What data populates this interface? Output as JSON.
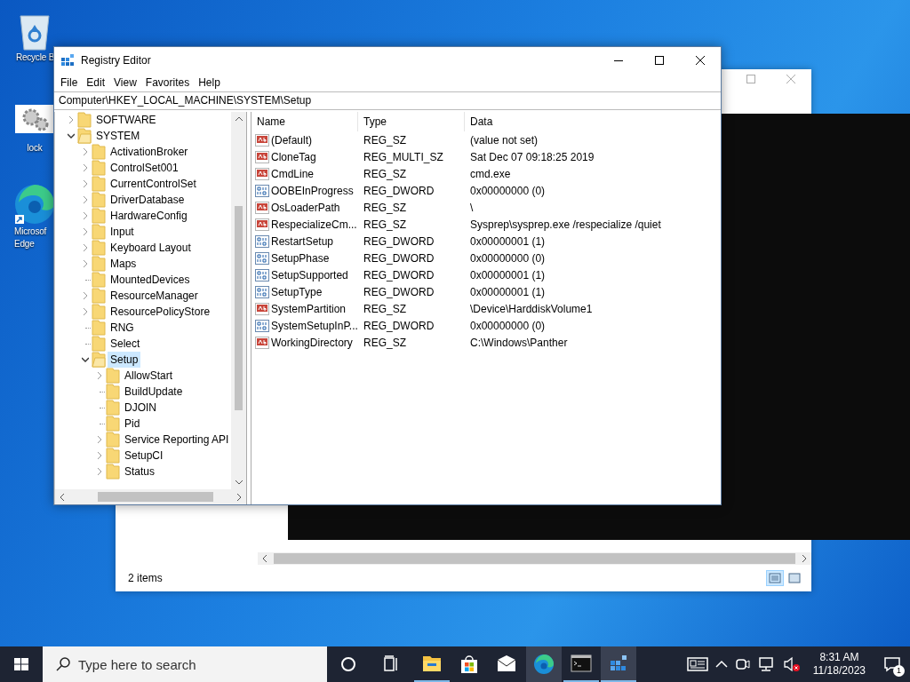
{
  "desktop_icons": [
    {
      "kind": "recycle",
      "lines": [
        "Recycle B"
      ]
    },
    {
      "kind": "gears",
      "lines": [
        "lock"
      ]
    },
    {
      "kind": "edge",
      "lines": [
        "Microsof",
        "Edge"
      ]
    }
  ],
  "explorer_window": {
    "status": "2 items"
  },
  "registry_editor": {
    "title": "Registry Editor",
    "menu": [
      "File",
      "Edit",
      "View",
      "Favorites",
      "Help"
    ],
    "address": "Computer\\HKEY_LOCAL_MACHINE\\SYSTEM\\Setup",
    "tree": [
      {
        "label": "SOFTWARE",
        "has_children": true,
        "expanded": false,
        "selected": false
      },
      {
        "label": "SYSTEM",
        "has_children": true,
        "expanded": true,
        "selected": false,
        "children": [
          {
            "label": "ActivationBroker",
            "has_children": true,
            "expanded": false,
            "selected": false
          },
          {
            "label": "ControlSet001",
            "has_children": true,
            "expanded": false,
            "selected": false
          },
          {
            "label": "CurrentControlSet",
            "has_children": true,
            "expanded": false,
            "selected": false
          },
          {
            "label": "DriverDatabase",
            "has_children": true,
            "expanded": false,
            "selected": false
          },
          {
            "label": "HardwareConfig",
            "has_children": true,
            "expanded": false,
            "selected": false
          },
          {
            "label": "Input",
            "has_children": true,
            "expanded": false,
            "selected": false
          },
          {
            "label": "Keyboard Layout",
            "has_children": true,
            "expanded": false,
            "selected": false
          },
          {
            "label": "Maps",
            "has_children": true,
            "expanded": false,
            "selected": false
          },
          {
            "label": "MountedDevices",
            "has_children": false,
            "expanded": false,
            "selected": false
          },
          {
            "label": "ResourceManager",
            "has_children": true,
            "expanded": false,
            "selected": false
          },
          {
            "label": "ResourcePolicyStore",
            "has_children": true,
            "expanded": false,
            "selected": false
          },
          {
            "label": "RNG",
            "has_children": false,
            "expanded": false,
            "selected": false
          },
          {
            "label": "Select",
            "has_children": false,
            "expanded": false,
            "selected": false
          },
          {
            "label": "Setup",
            "has_children": true,
            "expanded": true,
            "selected": true,
            "children": [
              {
                "label": "AllowStart",
                "has_children": true,
                "expanded": false,
                "selected": false
              },
              {
                "label": "BuildUpdate",
                "has_children": false,
                "expanded": false,
                "selected": false
              },
              {
                "label": "DJOIN",
                "has_children": false,
                "expanded": false,
                "selected": false
              },
              {
                "label": "Pid",
                "has_children": false,
                "expanded": false,
                "selected": false
              },
              {
                "label": "Service Reporting API",
                "has_children": true,
                "expanded": false,
                "selected": false
              },
              {
                "label": "SetupCI",
                "has_children": true,
                "expanded": false,
                "selected": false
              },
              {
                "label": "Status",
                "has_children": true,
                "expanded": false,
                "selected": false
              }
            ]
          }
        ]
      }
    ],
    "columns": [
      "Name",
      "Type",
      "Data"
    ],
    "values": [
      {
        "kind": "sz",
        "name": "(Default)",
        "type": "REG_SZ",
        "data": "(value not set)"
      },
      {
        "kind": "sz",
        "name": "CloneTag",
        "type": "REG_MULTI_SZ",
        "data": "Sat Dec 07 09:18:25 2019"
      },
      {
        "kind": "sz",
        "name": "CmdLine",
        "type": "REG_SZ",
        "data": "cmd.exe"
      },
      {
        "kind": "dword",
        "name": "OOBEInProgress",
        "type": "REG_DWORD",
        "data": "0x00000000 (0)"
      },
      {
        "kind": "sz",
        "name": "OsLoaderPath",
        "type": "REG_SZ",
        "data": "\\"
      },
      {
        "kind": "sz",
        "name": "RespecializeCm...",
        "type": "REG_SZ",
        "data": "Sysprep\\sysprep.exe /respecialize /quiet"
      },
      {
        "kind": "dword",
        "name": "RestartSetup",
        "type": "REG_DWORD",
        "data": "0x00000001 (1)"
      },
      {
        "kind": "dword",
        "name": "SetupPhase",
        "type": "REG_DWORD",
        "data": "0x00000000 (0)"
      },
      {
        "kind": "dword",
        "name": "SetupSupported",
        "type": "REG_DWORD",
        "data": "0x00000001 (1)"
      },
      {
        "kind": "dword",
        "name": "SetupType",
        "type": "REG_DWORD",
        "data": "0x00000001 (1)"
      },
      {
        "kind": "sz",
        "name": "SystemPartition",
        "type": "REG_SZ",
        "data": "\\Device\\HarddiskVolume1"
      },
      {
        "kind": "dword",
        "name": "SystemSetupInP...",
        "type": "REG_DWORD",
        "data": "0x00000000 (0)"
      },
      {
        "kind": "sz",
        "name": "WorkingDirectory",
        "type": "REG_SZ",
        "data": "C:\\Windows\\Panther"
      }
    ]
  },
  "taskbar": {
    "search_placeholder": "Type here to search",
    "apps": [
      {
        "kind": "explorer",
        "running": true,
        "active": false
      },
      {
        "kind": "store",
        "running": false,
        "active": false
      },
      {
        "kind": "mail",
        "running": false,
        "active": false
      },
      {
        "kind": "edge",
        "running": false,
        "active": true
      },
      {
        "kind": "cmd",
        "running": true,
        "active": false
      },
      {
        "kind": "regedit",
        "running": true,
        "active": true
      }
    ],
    "time": "8:31 AM",
    "date": "11/18/2023",
    "notification_count": "1"
  }
}
